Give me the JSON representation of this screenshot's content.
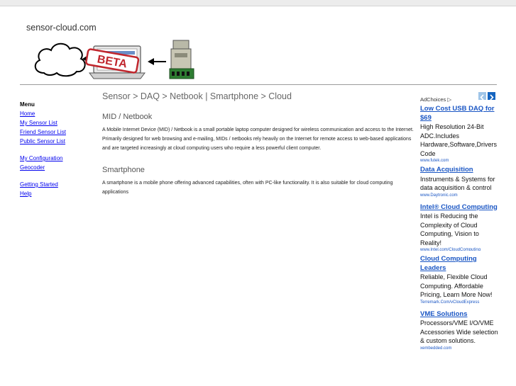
{
  "header": {
    "site_title": "sensor-cloud.com",
    "banner_badge": "BETA"
  },
  "menu": {
    "title": "Menu",
    "links_group1": [
      "Home",
      "My Sensor List",
      "Friend Sensor List",
      "Public Sensor List"
    ],
    "links_group2": [
      "My Configuration",
      "Geocoder"
    ],
    "links_group3": [
      "Getting Started",
      "Help"
    ]
  },
  "main": {
    "breadcrumb": "Sensor > DAQ > Netbook | Smartphone > Cloud",
    "sections": [
      {
        "title": "MID / Netbook",
        "text": "A Mobile Internet Device (MID) / Netbook is a small portable laptop computer designed for wireless communication and access to the Internet. Primarily designed for web browsing and e-mailing, MIDs / netbooks rely heavily on the Internet for remote access to web-based applications and are targeted increasingly at cloud computing users who require a less powerful client computer."
      },
      {
        "title": "Smartphone",
        "text": "A smartphone is a mobile phone offering advanced capabilities, often with PC-like functionality. It is also suitable for cloud computing applications"
      }
    ]
  },
  "ads": {
    "adchoices": "AdChoices",
    "items": [
      {
        "title": "Low Cost USB DAQ for $69",
        "body": "High Resolution 24-Bit ADC.Includes Hardware,Software,Drivers Code",
        "url": "www.futek.com"
      },
      {
        "title": "Data Acquisition",
        "body": "Instruments & Systems for data acquisition & control",
        "url": "www.Daytronic.com"
      },
      {
        "title": "Intel® Cloud Computing",
        "body": "Intel is Reducing the Complexity of Cloud Computing, Vision to Reality!",
        "url": "www.Intel.com/CloudComputing"
      },
      {
        "title": "Cloud Computing Leaders",
        "body": "Reliable, Flexible Cloud Computing. Affordable Pricing, Learn More Now!",
        "url": "Terremark.Com/vCloudExpress"
      },
      {
        "title": "VME Solutions",
        "body": "Processors/VME I/O/VME Accessories Wide selection & custom solutions.",
        "url": "xembedded.com"
      }
    ]
  }
}
